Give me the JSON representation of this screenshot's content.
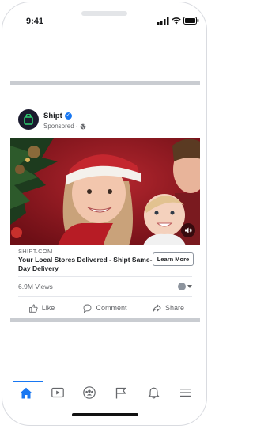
{
  "status_bar": {
    "time": "9:41"
  },
  "post": {
    "page_name": "Shipt",
    "sponsored_label": "Sponsored · ",
    "link": {
      "domain": "SHIPT.COM",
      "title": "Your Local Stores Delivered - Shipt Same-Day Delivery",
      "cta_label": "Learn More"
    },
    "views": "6.9M Views",
    "actions": {
      "like": "Like",
      "comment": "Comment",
      "share": "Share"
    }
  },
  "tabs": [
    {
      "icon": "home-icon",
      "active": true
    },
    {
      "icon": "video-icon",
      "active": false
    },
    {
      "icon": "groups-icon",
      "active": false
    },
    {
      "icon": "pages-flag-icon",
      "active": false
    },
    {
      "icon": "notifications-bell-icon",
      "active": false
    },
    {
      "icon": "menu-icon",
      "active": false
    }
  ],
  "colors": {
    "accent": "#1877f2",
    "separator": "#c9ccd1",
    "muted": "#65676b"
  }
}
